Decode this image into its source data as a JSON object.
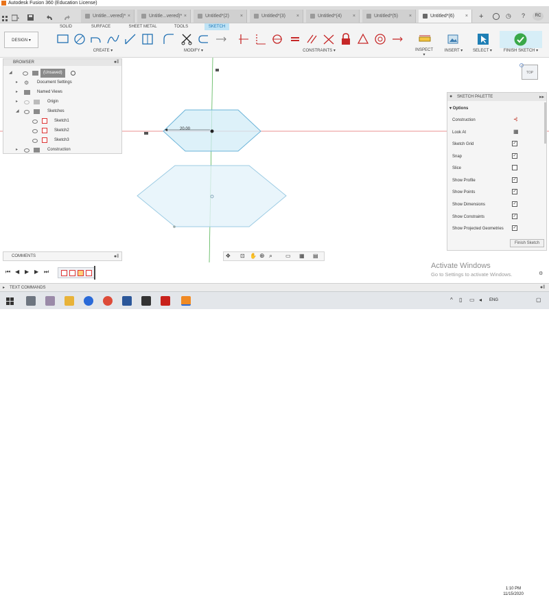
{
  "window": {
    "title": "Autodesk Fusion 360 (Education License)"
  },
  "doc_tabs": [
    {
      "label": "Untitle...vered)*",
      "active": false
    },
    {
      "label": "Untitle...vered)*",
      "active": false
    },
    {
      "label": "Untitled*(2)",
      "active": false
    },
    {
      "label": "Untitled*(3)",
      "active": false
    },
    {
      "label": "Untitled*(4)",
      "active": false
    },
    {
      "label": "Untitled*(5)",
      "active": false
    },
    {
      "label": "Untitled*(6)",
      "active": true
    }
  ],
  "user_initials": "RC",
  "workspace": {
    "label": "DESIGN ▾"
  },
  "workspace_tabs": [
    "SOLID",
    "SURFACE",
    "SHEET METAL",
    "TOOLS",
    "SKETCH"
  ],
  "groups": {
    "create": "CREATE ▾",
    "modify": "MODIFY ▾",
    "constraints": "CONSTRAINTS ▾",
    "inspect": "INSPECT ▾",
    "insert": "INSERT ▾",
    "select": "SELECT ▾",
    "finish": "FINISH SKETCH ▾"
  },
  "browser": {
    "title": "BROWSER",
    "items": [
      {
        "label": "(Unsaved)"
      },
      {
        "label": "Document Settings"
      },
      {
        "label": "Named Views"
      },
      {
        "label": "Origin"
      },
      {
        "label": "Sketches"
      },
      {
        "label": "Sketch1"
      },
      {
        "label": "Sketch2"
      },
      {
        "label": "Sketch3"
      },
      {
        "label": "Construction"
      }
    ]
  },
  "dimension": "20.00",
  "viewcube_label": "TOP",
  "palette": {
    "title": "SKETCH PALETTE",
    "section": "▾ Options",
    "rows": [
      {
        "label": "Construction",
        "checked": ""
      },
      {
        "label": "Look At",
        "checked": ""
      },
      {
        "label": "Sketch Grid",
        "checked": "✓"
      },
      {
        "label": "Snap",
        "checked": "✓"
      },
      {
        "label": "Slice",
        "checked": ""
      },
      {
        "label": "Show Profile",
        "checked": "✓"
      },
      {
        "label": "Show Points",
        "checked": "✓"
      },
      {
        "label": "Show Dimensions",
        "checked": "✓"
      },
      {
        "label": "Show Constraints",
        "checked": "✓"
      },
      {
        "label": "Show Projected Geometries",
        "checked": "✓"
      }
    ],
    "finish_label": "Finish Sketch"
  },
  "comments": "COMMENTS",
  "text_commands": "TEXT COMMANDS",
  "watermark": {
    "line1": "Activate Windows",
    "line2": "Go to Settings to activate Windows."
  },
  "tray": {
    "lang": "ENG",
    "time": "1:10 PM",
    "date": "11/15/2020"
  }
}
